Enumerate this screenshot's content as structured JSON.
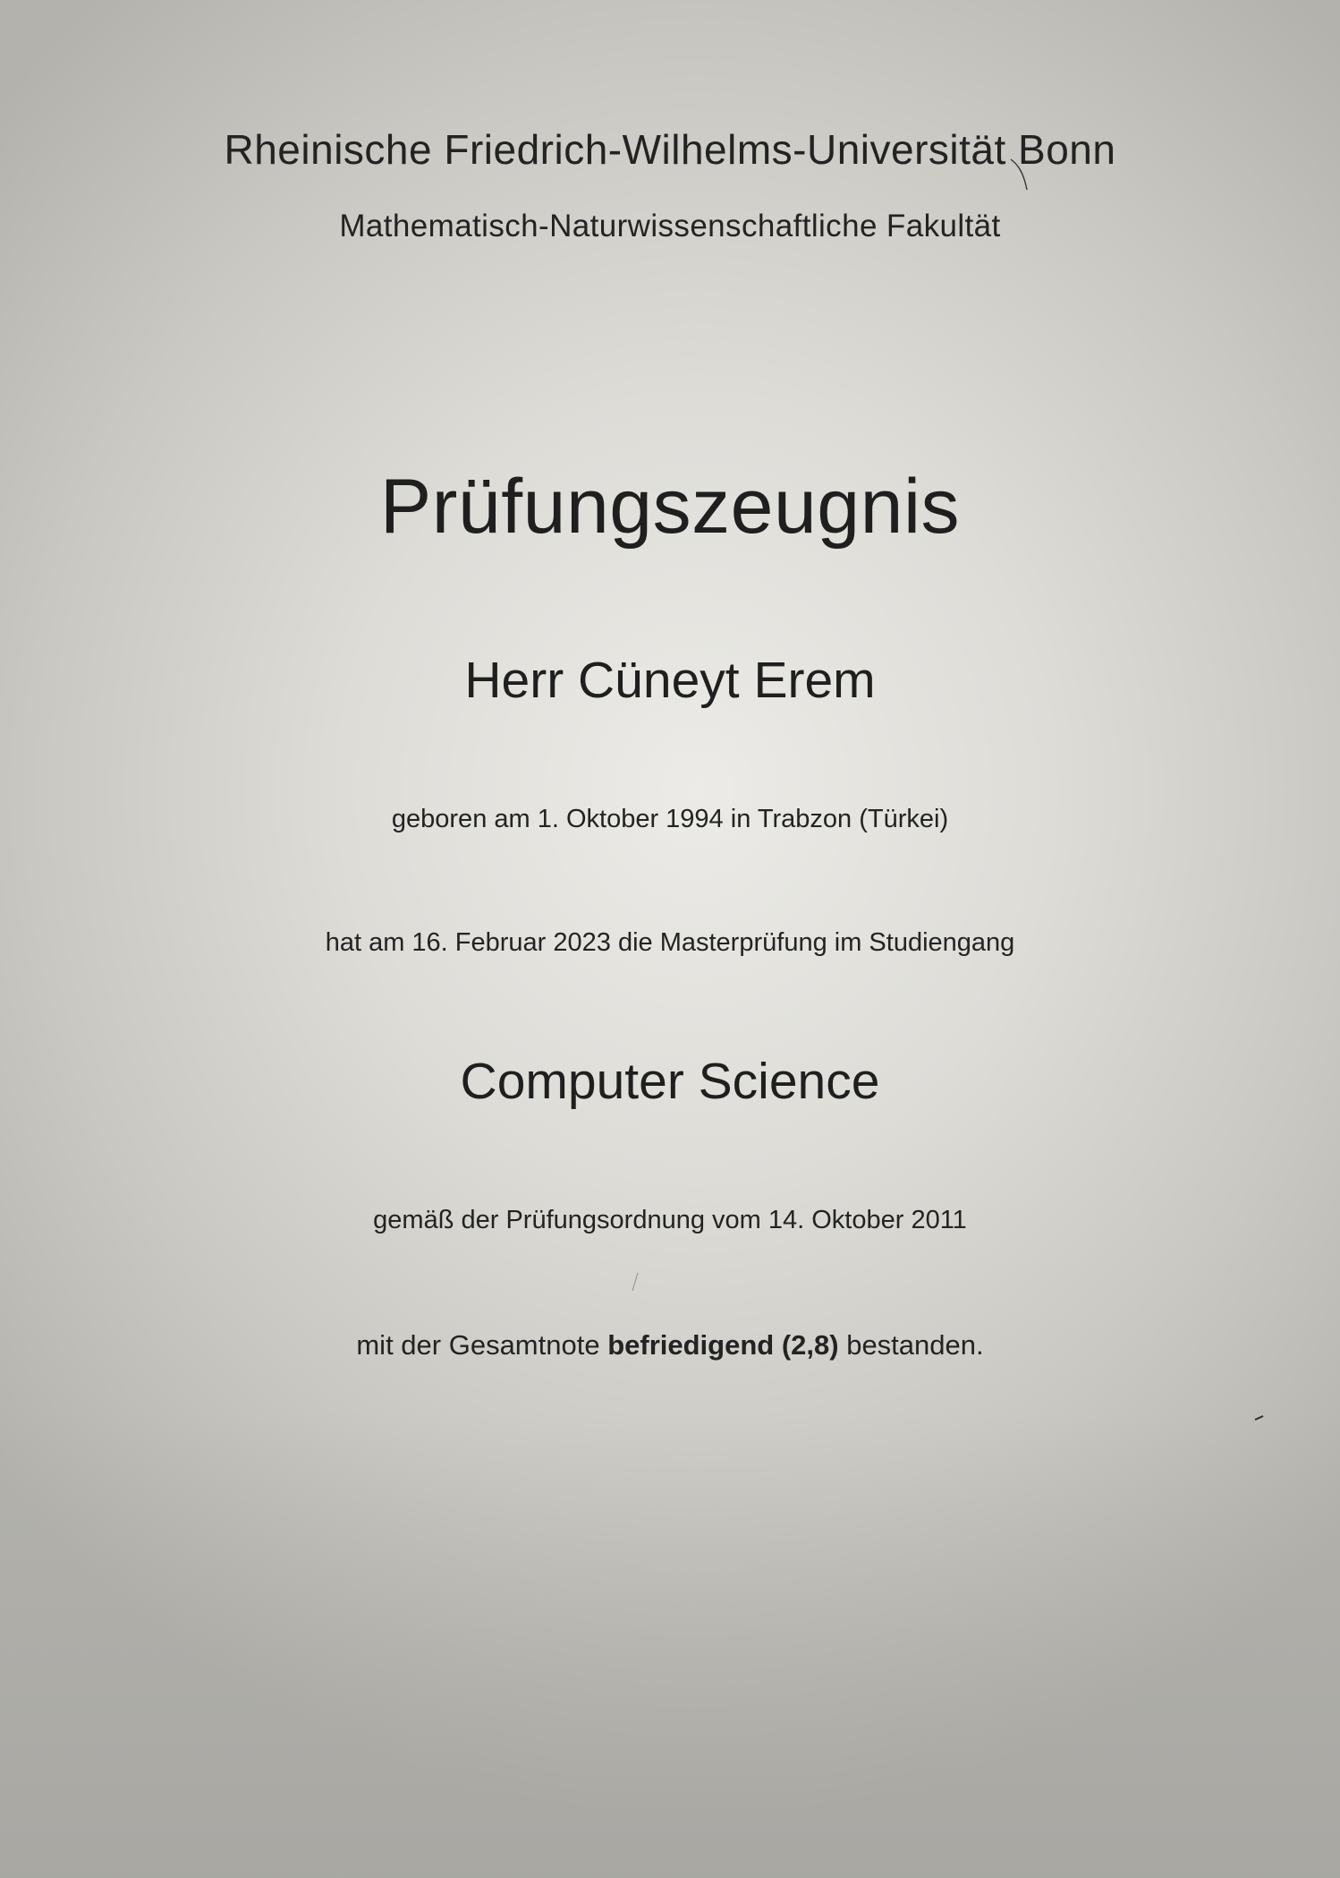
{
  "university": "Rheinische Friedrich-Wilhelms-Universität Bonn",
  "faculty": "Mathematisch-Naturwissenschaftliche Fakultät",
  "title": "Prüfungszeugnis",
  "recipient": "Herr Cüneyt Erem",
  "birth_line": "geboren am 1. Oktober 1994 in Trabzon (Türkei)",
  "exam_line": "hat am 16. Februar 2023 die Masterprüfung im Studiengang",
  "program": "Computer Science",
  "regulation_line": "gemäß der Prüfungsordnung vom 14. Oktober 2011",
  "grade": {
    "prefix": "mit der Gesamtnote",
    "value": "befriedigend (2,8)",
    "suffix": "bestanden."
  }
}
